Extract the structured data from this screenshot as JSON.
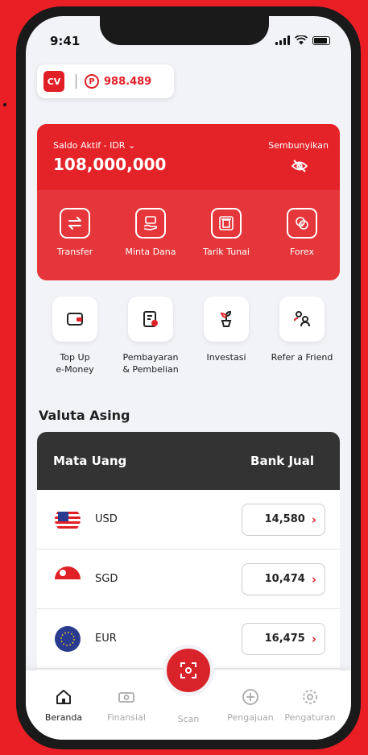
{
  "status_bar": {
    "time": "9:41"
  },
  "profile": {
    "initials": "CV",
    "points_symbol": "P",
    "points": "988.489"
  },
  "balance": {
    "label": "Saldo Aktif - IDR",
    "amount": "108,000,000",
    "hide_label": "Sembunyikan"
  },
  "actions": [
    {
      "label": "Transfer",
      "icon": "transfer-icon"
    },
    {
      "label": "Minta Dana",
      "icon": "request-funds-icon"
    },
    {
      "label": "Tarik Tunai",
      "icon": "cash-withdrawal-icon"
    },
    {
      "label": "Forex",
      "icon": "forex-icon"
    }
  ],
  "menu": [
    {
      "label": "Top Up\ne-Money",
      "icon": "wallet-icon"
    },
    {
      "label": "Pembayaran\n& Pembelian",
      "icon": "bill-icon"
    },
    {
      "label": "Investasi",
      "icon": "plant-icon"
    },
    {
      "label": "Refer a Friend",
      "icon": "refer-icon"
    }
  ],
  "forex": {
    "title": "Valuta Asing",
    "col_currency": "Mata Uang",
    "col_rate": "Bank Jual",
    "rows": [
      {
        "code": "USD",
        "rate": "14,580"
      },
      {
        "code": "SGD",
        "rate": "10,474"
      },
      {
        "code": "EUR",
        "rate": "16,475"
      }
    ]
  },
  "nav": {
    "home": "Beranda",
    "finance": "Finansial",
    "scan": "Scan",
    "apply": "Pengajuan",
    "settings": "Pengaturan"
  },
  "colors": {
    "brand_red": "#e42329",
    "dark_header": "#333333"
  }
}
